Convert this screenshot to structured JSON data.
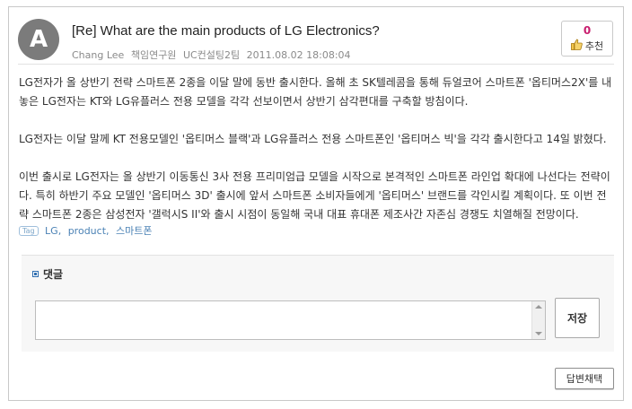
{
  "post": {
    "avatar_letter": "A",
    "title": "[Re] What are the main products of LG Electronics?",
    "author": "Chang Lee",
    "author_title": "책임연구원",
    "department": "UC컨설팅2팀",
    "datetime": "2011.08.02 18:08:04",
    "recommend_count": "0",
    "recommend_label": "추천",
    "paragraphs": [
      "LG전자가 올 상반기 전략 스마트폰 2종을 이달 말에 동반 출시한다. 올해 초 SK텔레콤을 통해 듀얼코어 스마트폰 '옵티머스2X'를 내놓은 LG전자는 KT와 LG유플러스 전용 모델을 각각 선보이면서 상반기 삼각편대를 구축할 방침이다.",
      "LG전자는 이달 말께 KT 전용모델인 '옵티머스 블랙'과 LG유플러스 전용 스마트폰인 '옵티머스 빅'을 각각 출시한다고 14일 밝혔다.",
      "이번 출시로 LG전자는 올 상반기 이동통신 3사 전용 프리미엄급 모델을 시작으로 본격적인 스마트폰 라인업 확대에 나선다는 전략이다. 특히 하반기 주요 모델인 '옵티머스 3D' 출시에 앞서 스마트폰 소비자들에게 '옵티머스' 브랜드를 각인시킬 계획이다. 또 이번 전략 스마트폰 2종은 삼성전자 '갤럭시S II'와 출시 시점이 동일해 국내 대표 휴대폰 제조사간 자존심 경쟁도 치열해질 전망이다."
    ],
    "tag_badge": "Tag",
    "tags": [
      "LG",
      "product",
      "스마트폰"
    ]
  },
  "comments": {
    "label": "댓글",
    "input_value": "",
    "submit_label": "저장"
  },
  "actions": {
    "adopt_answer_label": "답변채택"
  },
  "colors": {
    "recommend_count": "#c81e6e",
    "tag_link": "#4b82b5",
    "avatar_bg": "#7b7b7b"
  }
}
